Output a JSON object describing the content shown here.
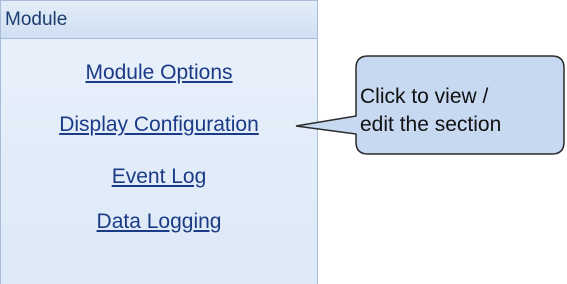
{
  "panel": {
    "title": "Module",
    "links": [
      {
        "label": "Module Options"
      },
      {
        "label": "Display Configuration"
      },
      {
        "label": "Event Log"
      },
      {
        "label": "Data Logging"
      }
    ]
  },
  "callout": {
    "line1": "Click to view /",
    "line2": "edit the section"
  },
  "colors": {
    "link": "#1b3b86",
    "panel_bg": "#e4eefa",
    "callout_fill": "#c6d9f1",
    "callout_border": "#2b2b2b"
  }
}
